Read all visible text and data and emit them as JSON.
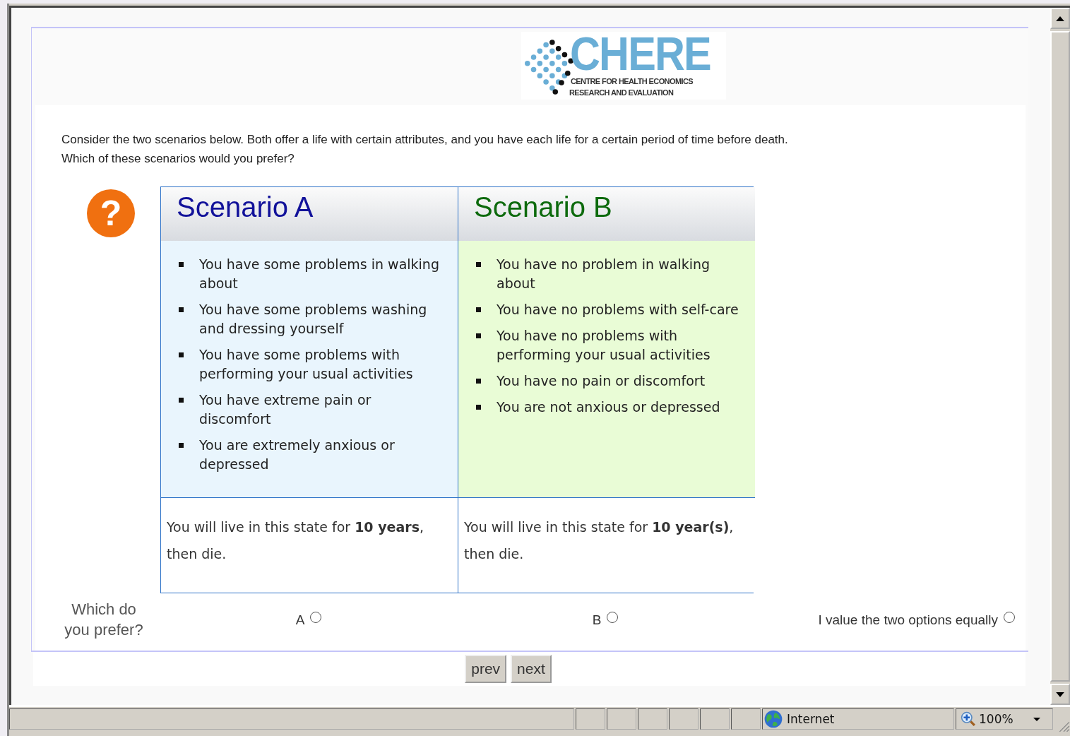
{
  "logo": {
    "name": "CHERE",
    "line_1": "CENTRE FOR HEALTH ECONOMICS",
    "line_2": "RESEARCH AND EVALUATION"
  },
  "instructions": [
    "Consider the two scenarios below. Both offer a life with certain attributes, and you have each life for a certain period of time before death.",
    "Which of these scenarios would you prefer?"
  ],
  "help_icon": "?",
  "scenarios": [
    {
      "kind": "a",
      "title": "Scenario A",
      "attributes": [
        "You have some problems in walking about",
        "You have some problems washing and dressing yourself",
        "You have some problems with performing your usual activities",
        "You have extreme pain or discomfort",
        "You are extremely anxious or depressed"
      ],
      "duration": "You will live in this state for **10 years**, then die."
    },
    {
      "kind": "b",
      "title": "Scenario B",
      "attributes": [
        "You have no problem in walking about",
        "You have no problems with self-care",
        "You have no problems with performing your usual activities",
        "You have no pain or discomfort",
        "You are not anxious or depressed"
      ],
      "duration": "You will live in this state for **10 year(s)**, then die."
    }
  ],
  "question": "Which do you prefer?",
  "choices": [
    {
      "label": "A",
      "selected": false
    },
    {
      "label": "B",
      "selected": false
    },
    {
      "label": "I value the two options equally",
      "selected": false
    }
  ],
  "nav_buttons": [
    "prev",
    "next"
  ],
  "status_bar": {
    "zone": "Internet",
    "zoom": "100%"
  }
}
